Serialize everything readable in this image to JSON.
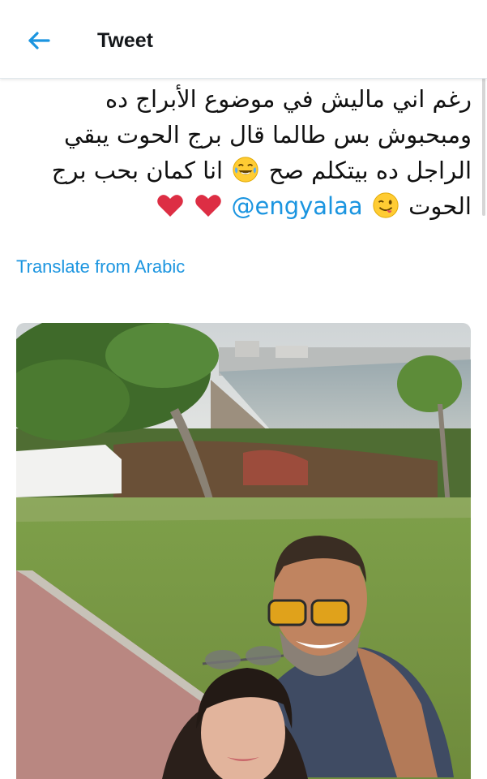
{
  "header": {
    "title": "Tweet",
    "back_icon": "arrow-left-icon",
    "accent": "#1b95e0"
  },
  "tweet": {
    "line1": "رغم اني ماليش في موضوع الأبراج ده",
    "line2": "ومبحبوش بس طالما قال برج الحوت يبقي",
    "line3a": "الراجل ده بيتكلم صح",
    "line3b": "انا كمان بحب برج",
    "line4a": "الحوت",
    "mention": "@engyalaa",
    "emoji_laugh": "face-with-tears-of-joy",
    "emoji_wink": "winking-face-with-tongue",
    "hearts": "heart-icon"
  },
  "translate": {
    "label": "Translate from Arabic"
  },
  "media": {
    "type": "photo",
    "description_icon": "photo-icon"
  }
}
